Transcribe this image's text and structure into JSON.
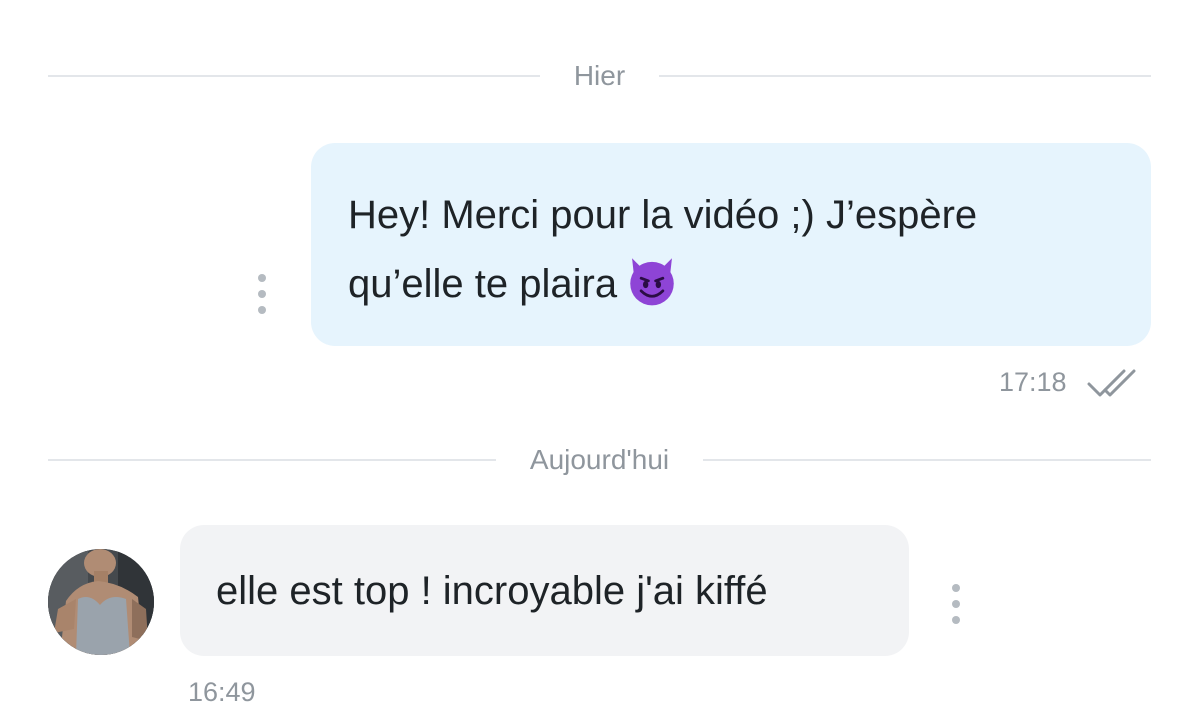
{
  "separators": {
    "yesterday": "Hier",
    "today": "Aujourd'hui"
  },
  "messages": [
    {
      "direction": "outgoing",
      "text_line1": "Hey! Merci pour la vidéo ;) J’espère",
      "text_line2": "qu’elle te plaira",
      "emoji": "smiling-devil-emoji",
      "time": "17:18",
      "status_icon": "double-check-icon"
    },
    {
      "direction": "incoming",
      "text": "elle est top ! incroyable j'ai kiffé",
      "time": "16:49"
    }
  ],
  "colors": {
    "outgoing_bubble": "#e6f4fd",
    "incoming_bubble": "#f2f3f5",
    "meta_text": "#8f969d",
    "message_text": "#1e2327",
    "divider_line": "#e3e6ea",
    "emoji": "#8e44d6"
  }
}
